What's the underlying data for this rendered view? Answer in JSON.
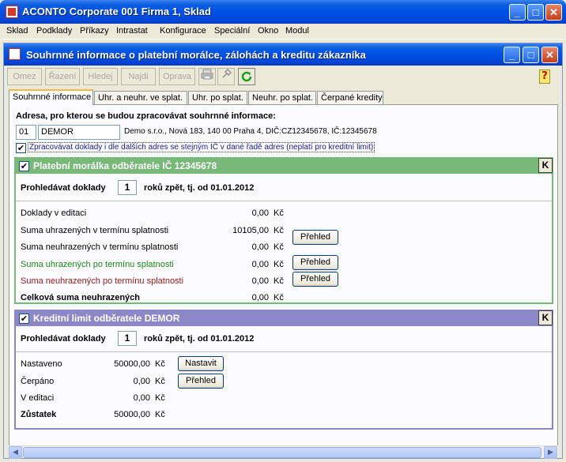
{
  "app": {
    "title": "ACONTO Corporate 001 Firma 1, Sklad",
    "window_buttons": {
      "minimize": "_",
      "maximize": "□",
      "close": "✕"
    }
  },
  "menu": [
    "Sklad",
    "Podklady",
    "Příkazy",
    "Intrastat",
    "Konfigurace",
    "Speciální",
    "Okno",
    "Modul"
  ],
  "dialog": {
    "title": "Souhrnné informace o platební morálce, zálohách a kreditu zákazníka"
  },
  "toolbar": {
    "buttons": [
      "Omez",
      "Řazení",
      "Hledej",
      "Najdi",
      "Oprava"
    ],
    "help": "?"
  },
  "tabs": [
    "Souhrnné informace",
    "Uhr. a neuhr. ve splat.",
    "Uhr. po splat.",
    "Neuhr. po splat.",
    "Čerpané kredity"
  ],
  "address": {
    "heading": "Adresa, pro kterou se budou zpracovávat souhrnné informace:",
    "code": "01",
    "name": "DEMOR",
    "detail": "Demo s.r.o., Nová 183, 140 00 Praha 4, DIČ:CZ12345678, IČ:12345678",
    "checkbox_label": "Zpracovávat doklady i dle dalších adres se stejným IČ v dané řadě adres (neplatí pro kreditní limit)",
    "checkbox_checked": true
  },
  "payment": {
    "title": "Platební morálka odběratele IČ 12345678",
    "k_label": "K",
    "search_prefix": "Prohledávat doklady",
    "years": "1",
    "search_suffix": "roků zpět, tj. od 01.01.2012",
    "rows": [
      {
        "label": "Doklady v editaci",
        "value": "0,00",
        "currency": "Kč",
        "color": "#000000",
        "bold": false,
        "button": ""
      },
      {
        "label": "Suma uhrazených v termínu splatnosti",
        "value": "10105,00",
        "currency": "Kč",
        "color": "#000000",
        "bold": false,
        "button": "Přehled"
      },
      {
        "label": "Suma neuhrazených v termínu splatnosti",
        "value": "0,00",
        "currency": "Kč",
        "color": "#000000",
        "bold": false,
        "button": ""
      },
      {
        "label": "Suma uhrazených po termínu splatnosti",
        "value": "0,00",
        "currency": "Kč",
        "color": "#1a8a1a",
        "bold": false,
        "button": "Přehled"
      },
      {
        "label": "Suma neuhrazených po termínu splatnosti",
        "value": "0,00",
        "currency": "Kč",
        "color": "#a01818",
        "bold": false,
        "button": "Přehled"
      },
      {
        "label": "Celková suma neuhrazených",
        "value": "0,00",
        "currency": "Kč",
        "color": "#000000",
        "bold": true,
        "button": ""
      }
    ]
  },
  "credit": {
    "title": "Kreditní limit odběratele DEMOR",
    "k_label": "K",
    "search_prefix": "Prohledávat doklady",
    "years": "1",
    "search_suffix": "roků zpět, tj. od 01.01.2012",
    "rows": [
      {
        "label": "Nastaveno",
        "value": "50000,00",
        "currency": "Kč",
        "bold": false,
        "button": "Nastavit"
      },
      {
        "label": "Čerpáno",
        "value": "0,00",
        "currency": "Kč",
        "bold": false,
        "button": "Přehled"
      },
      {
        "label": "V editaci",
        "value": "0,00",
        "currency": "Kč",
        "bold": false,
        "button": ""
      },
      {
        "label": "Zůstatek",
        "value": "50000,00",
        "currency": "Kč",
        "bold": true,
        "button": ""
      }
    ]
  },
  "colors": {
    "payment_panel": "#78b878",
    "credit_panel": "#8c88c8",
    "title_blue": "#0050e8"
  }
}
